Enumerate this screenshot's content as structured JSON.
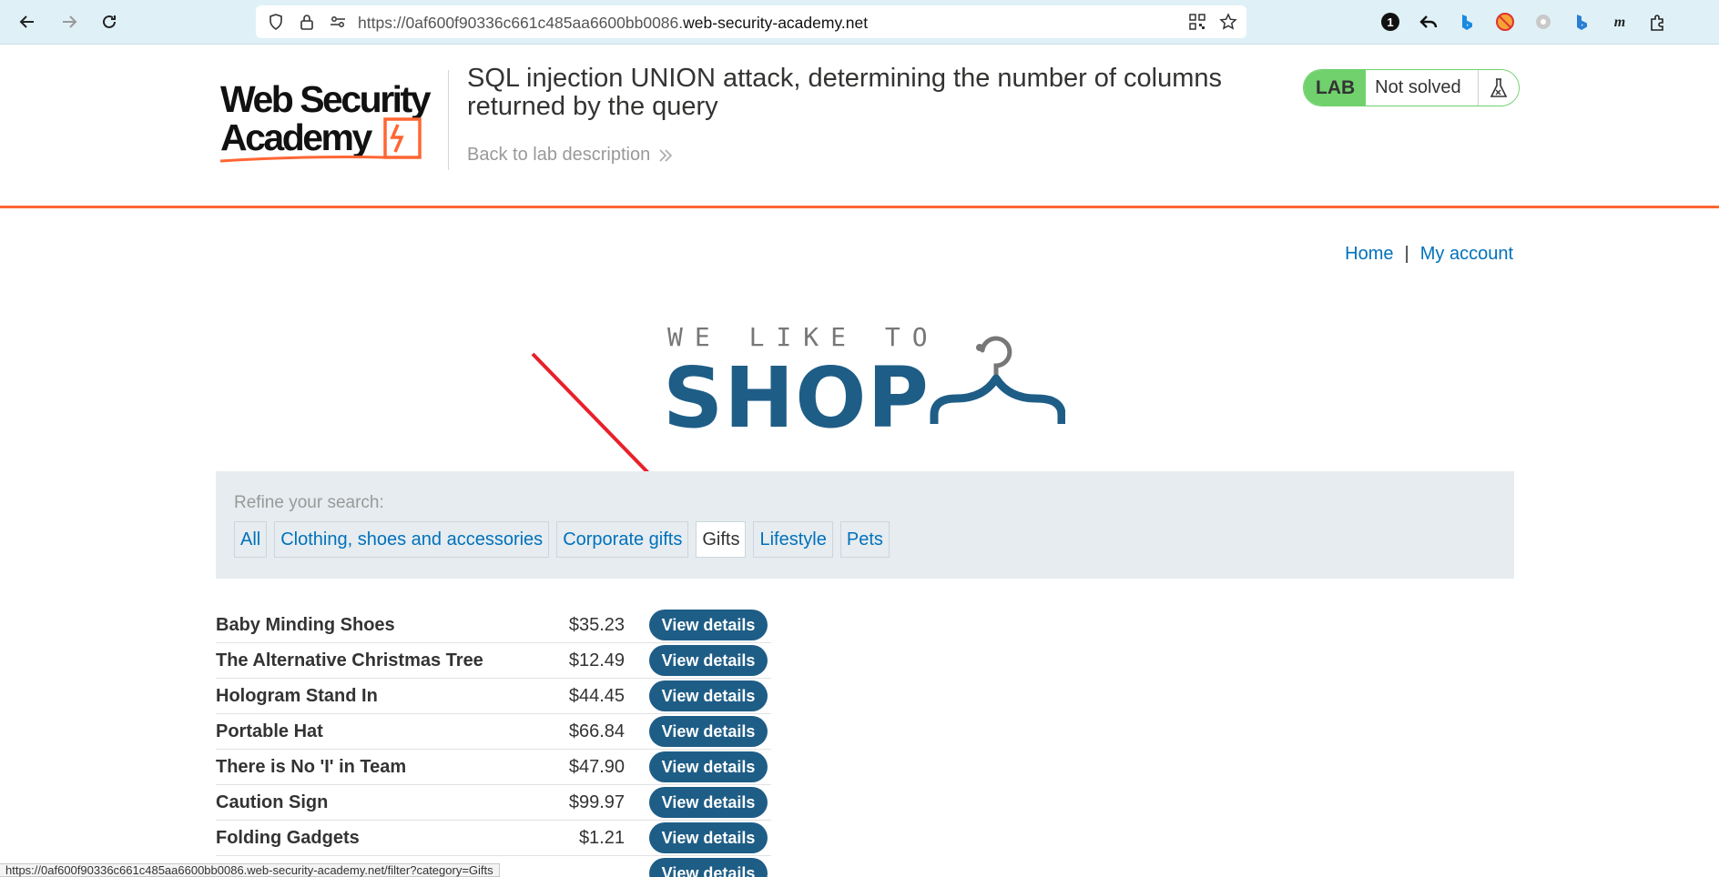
{
  "browser": {
    "url_prefix": "https://0af600f90336c661c485aa6600bb0086.",
    "url_host": "web-security-academy.net",
    "ext_badge_count": "1",
    "status_url": "https://0af600f90336c661c485aa6600bb0086.web-security-academy.net/filter?category=Gifts"
  },
  "lab": {
    "logo_line1": "Web Security",
    "logo_line2": "Academy",
    "title": "SQL injection UNION attack, determining the number of columns returned by the query",
    "back_link": "Back to lab description",
    "badge_tag": "LAB",
    "badge_status": "Not solved"
  },
  "nav": {
    "home": "Home",
    "separator": "|",
    "account": "My account"
  },
  "shop_logo": {
    "tagline": "WE LIKE TO",
    "word": "SHOP"
  },
  "filter": {
    "label": "Refine your search:",
    "categories": [
      {
        "label": "All",
        "active": false
      },
      {
        "label": "Clothing, shoes and accessories",
        "active": false
      },
      {
        "label": "Corporate gifts",
        "active": false
      },
      {
        "label": "Gifts",
        "active": true
      },
      {
        "label": "Lifestyle",
        "active": false
      },
      {
        "label": "Pets",
        "active": false
      }
    ]
  },
  "products": [
    {
      "name": "Baby Minding Shoes",
      "price": "$35.23",
      "button": "View details"
    },
    {
      "name": "The Alternative Christmas Tree",
      "price": "$12.49",
      "button": "View details"
    },
    {
      "name": "Hologram Stand In",
      "price": "$44.45",
      "button": "View details"
    },
    {
      "name": "Portable Hat",
      "price": "$66.84",
      "button": "View details"
    },
    {
      "name": "There is No 'I' in Team",
      "price": "$47.90",
      "button": "View details"
    },
    {
      "name": "Caution Sign",
      "price": "$99.97",
      "button": "View details"
    },
    {
      "name": "Folding Gadgets",
      "price": "$1.21",
      "button": "View details"
    },
    {
      "name": "",
      "price": "",
      "button": "View details"
    }
  ],
  "colors": {
    "accent_orange": "#ff6633",
    "shop_blue": "#1e5d86",
    "link_blue": "#0071bc",
    "lab_green": "#70d16d",
    "annotation_red": "#e8202a"
  },
  "icons": [
    "back-icon",
    "forward-icon",
    "reload-icon",
    "shield-icon",
    "lock-icon",
    "site-settings-icon",
    "qr-code-icon",
    "star-icon",
    "flask-icon",
    "hanger-icon",
    "arrow-annotation"
  ]
}
